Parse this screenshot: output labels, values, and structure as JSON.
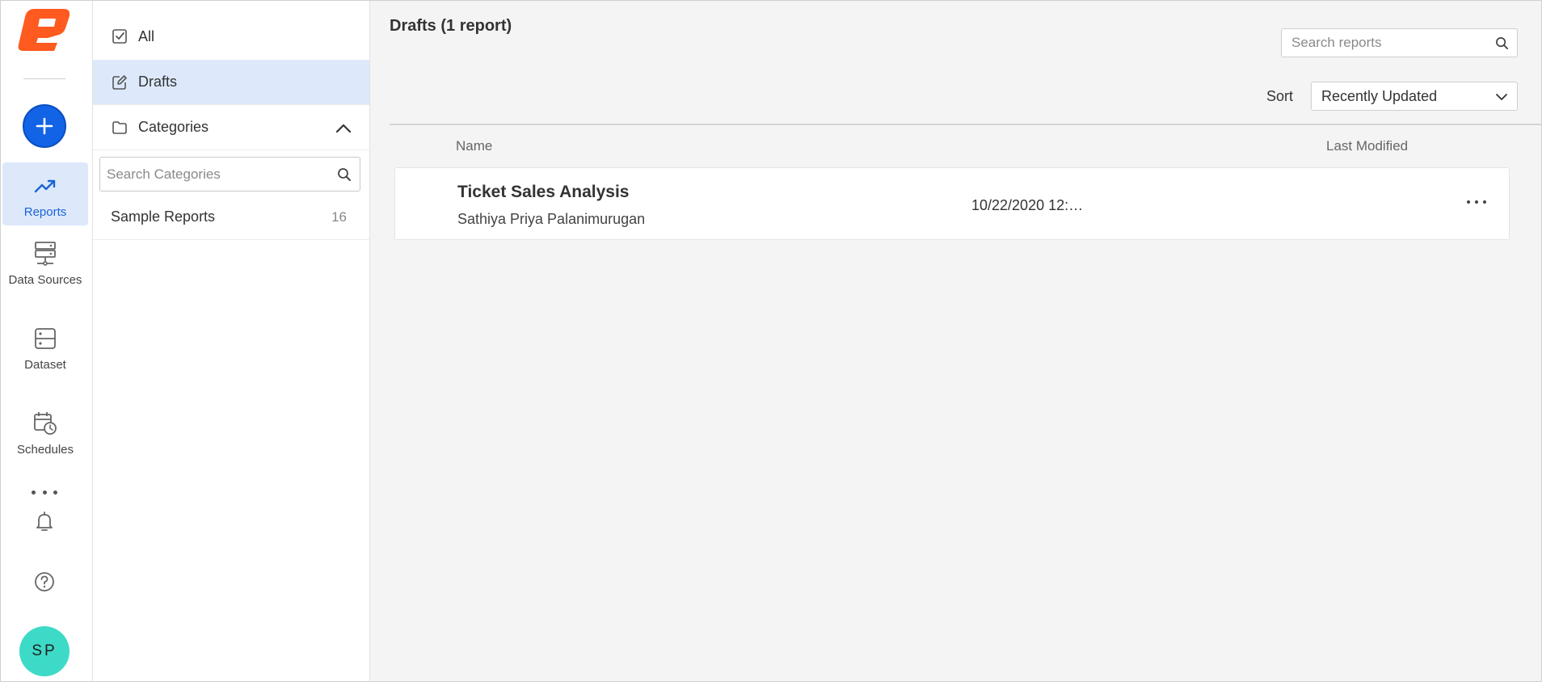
{
  "rail": {
    "add_label": "+",
    "items": [
      {
        "label": "Reports",
        "icon": "trending-up-icon",
        "active": true
      },
      {
        "label": "Data Sources",
        "icon": "server-icon"
      },
      {
        "label": "Dataset",
        "icon": "dataset-icon"
      },
      {
        "label": "Schedules",
        "icon": "calendar-clock-icon"
      }
    ],
    "user_initials": "SP",
    "accent_color": "#1263e6",
    "avatar_color": "#3ddac7",
    "logo_color": "#ff5a1f"
  },
  "categories": {
    "rows": [
      {
        "label": "All",
        "icon": "checkbox-icon"
      },
      {
        "label": "Drafts",
        "icon": "edit-icon",
        "selected": true
      },
      {
        "label": "Categories",
        "icon": "folder-icon",
        "expanded": true
      }
    ],
    "search_placeholder": "Search Categories",
    "items": [
      {
        "label": "Sample Reports",
        "count": "16"
      }
    ]
  },
  "main": {
    "title": "Drafts (1 report)",
    "search_placeholder": "Search reports",
    "sort_label": "Sort",
    "sort_value": "Recently Updated",
    "columns": {
      "name": "Name",
      "modified": "Last Modified"
    },
    "reports": [
      {
        "name": "Ticket Sales Analysis",
        "owner": "Sathiya Priya Palanimurugan",
        "modified": "10/22/2020 12:…"
      }
    ]
  }
}
